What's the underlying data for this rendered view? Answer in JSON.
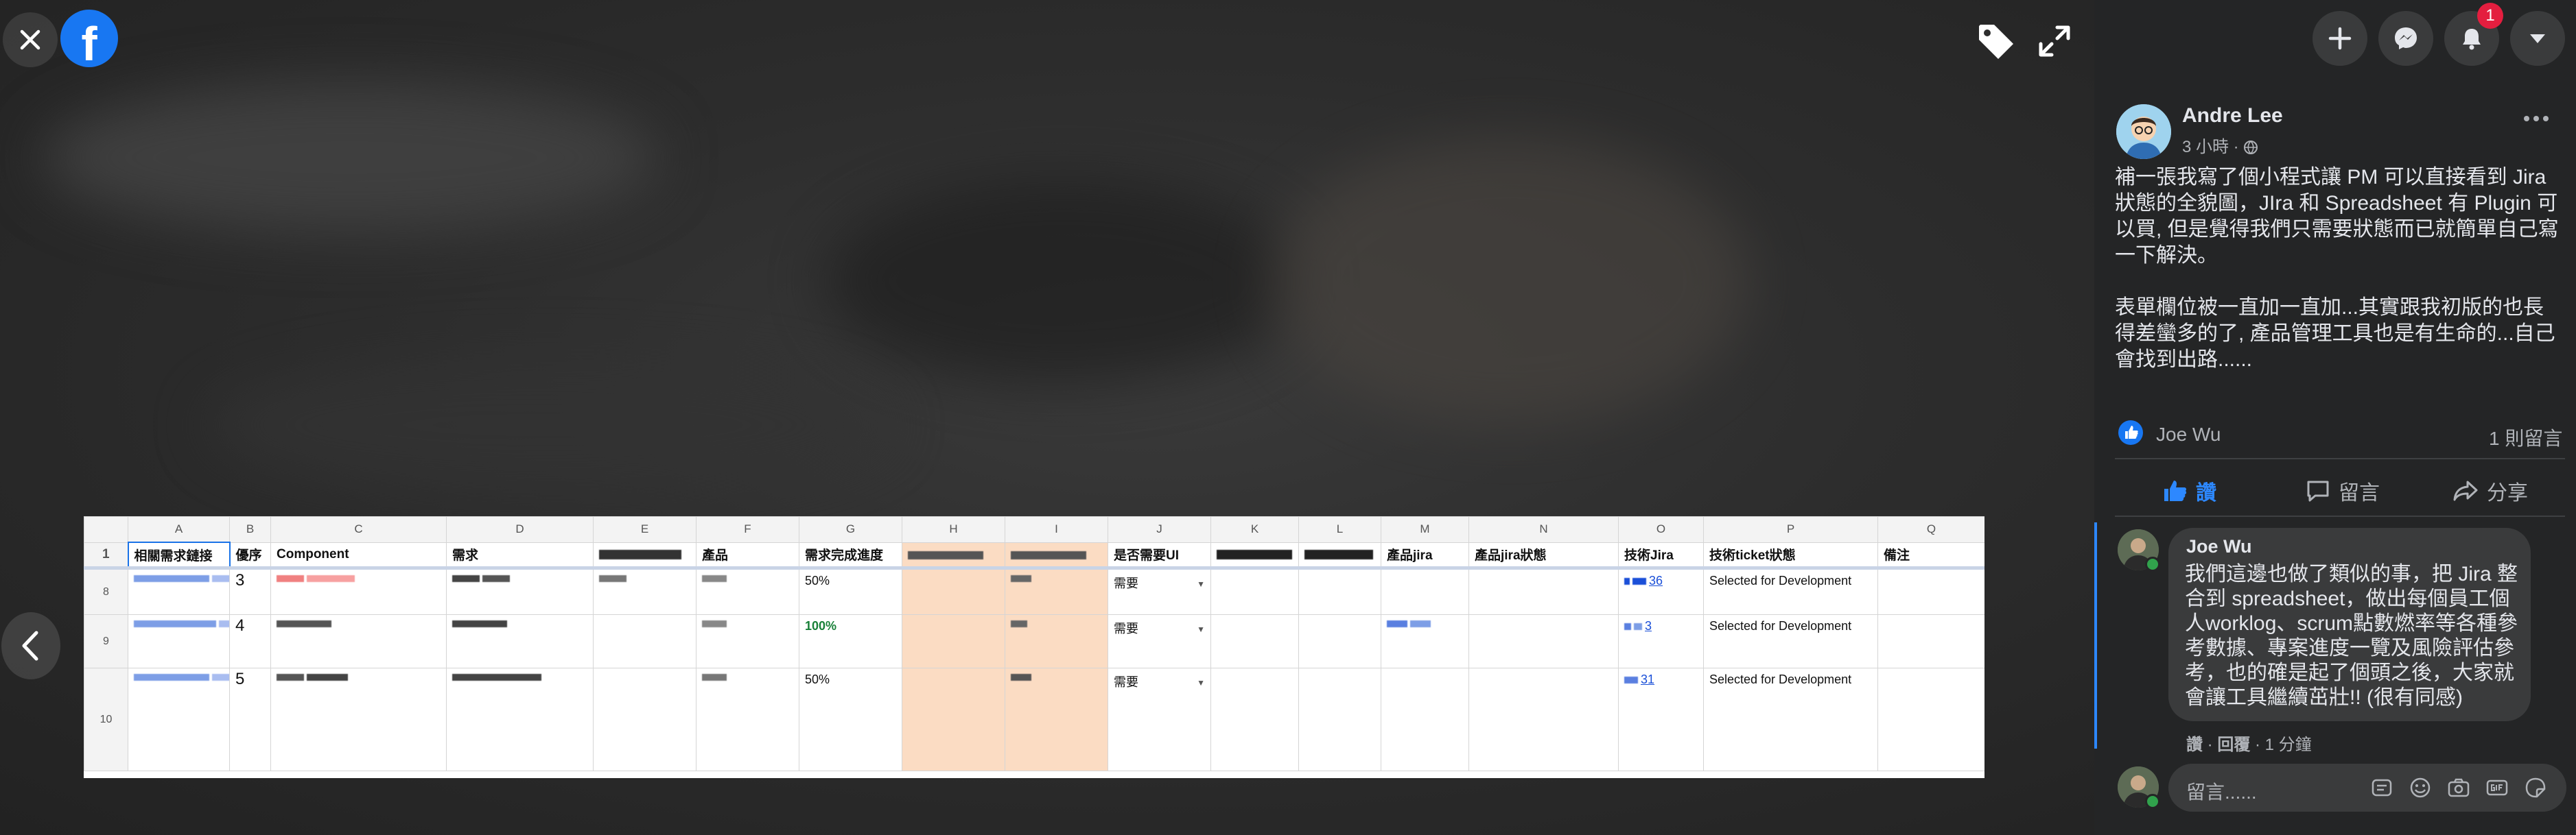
{
  "viewer": {
    "icons": [
      "close-icon",
      "facebook-logo",
      "tag-icon",
      "expand-icon",
      "chevron-left-icon"
    ]
  },
  "sheet": {
    "col_letters": [
      "A",
      "B",
      "C",
      "D",
      "E",
      "F",
      "G",
      "H",
      "I",
      "J",
      "K",
      "L",
      "M",
      "N",
      "O",
      "P",
      "Q"
    ],
    "headers": {
      "A": "相關需求鏈接",
      "B": "優序",
      "C": "Component",
      "D": "需求",
      "F": "產品",
      "G": "需求完成進度",
      "J": "是否需要UI",
      "M": "產品jira",
      "N": "產品jira狀態",
      "O": "技術Jira",
      "P": "技術ticket狀態",
      "Q": "備注"
    },
    "row_header_number": "1",
    "rows": [
      {
        "row_num": "8",
        "priority": "3",
        "progress": "50%",
        "needs_ui": "需要",
        "jira_num": "36",
        "ticket_status": "Selected for Development"
      },
      {
        "row_num": "9",
        "priority": "4",
        "progress": "100%",
        "needs_ui": "需要",
        "jira_num": "3",
        "ticket_status": "Selected for Development"
      },
      {
        "row_num": "10",
        "priority": "5",
        "progress": "50%",
        "needs_ui": "需要",
        "jira_num": "31",
        "ticket_status": "Selected for Development"
      }
    ]
  },
  "panel": {
    "top_icons": [
      "plus-icon",
      "messenger-icon",
      "bell-icon",
      "caret-down-icon"
    ],
    "notification_count": "1",
    "author": "Andre Lee",
    "post_time": "3 小時 · ",
    "post_text": "補一張我寫了個小程式讓 PM 可以直接看到 Jira 狀態的全貌圖，JIra 和 Spreadsheet 有 Plugin 可以買, 但是覺得我們只需要狀態而已就簡單自己寫一下解決。\n\n表單欄位被一直加一直加...其實跟我初版的也長得差蠻多的了, 產品管理工具也是有生命的...自己會找到出路......",
    "liker": "Joe Wu",
    "comment_count": "1 則留言",
    "actions": {
      "like": "讚",
      "comment": "留言",
      "share": "分享"
    },
    "comment": {
      "author": "Joe Wu",
      "text": "我們這邊也做了類似的事，把 Jira 整合到 spreadsheet，做出每個員工個人worklog、scrum點數燃率等各種參考數據、專案進度一覽及風險評估參考，也的確是起了個頭之後，大家就會讓工具繼續茁壯!! (很有同感)",
      "like": "讚",
      "reply": "回覆",
      "time": "1 分鐘",
      "sep": " · "
    },
    "compose_placeholder": "留言......",
    "compose_icons": [
      "sticker-icon",
      "emoji-icon",
      "camera-icon",
      "gif-icon",
      "sticker-face-icon"
    ]
  }
}
